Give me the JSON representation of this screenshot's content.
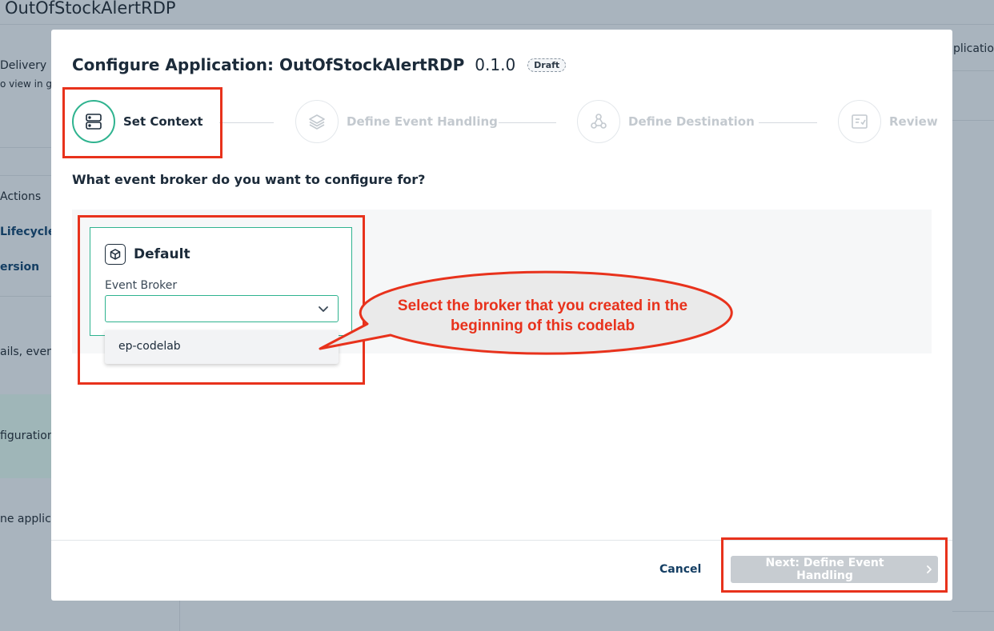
{
  "background": {
    "app_title": "OutOfStockAlertRDP",
    "left_items": [
      {
        "text": "Delivery F",
        "style": "normal"
      },
      {
        "text": "o view in gr",
        "style": "small"
      },
      {
        "text": "Actions",
        "style": "normal"
      },
      {
        "text": "Lifecycle",
        "style": "bold"
      },
      {
        "text": "ersion",
        "style": "bold"
      },
      {
        "text": "ails, even",
        "style": "normal"
      },
      {
        "text": "figuration",
        "style": "normal"
      },
      {
        "text": "ne applic",
        "style": "normal"
      }
    ],
    "right_tab": "plication"
  },
  "modal": {
    "title_prefix": "Configure Application:",
    "app_name": "OutOfStockAlertRDP",
    "version": "0.1.0",
    "status_badge": "Draft",
    "steps": [
      {
        "label": "Set Context",
        "icon": "server-icon",
        "active": true
      },
      {
        "label": "Define Event Handling",
        "icon": "layers-icon",
        "active": false
      },
      {
        "label": "Define Destination",
        "icon": "webhook-icon",
        "active": false
      },
      {
        "label": "Review",
        "icon": "checklist-icon",
        "active": false
      }
    ],
    "question": "What event broker do you want to configure for?",
    "card": {
      "name": "Default",
      "icon": "cube-icon",
      "field_label": "Event Broker",
      "selected_value": ""
    },
    "dropdown_options": [
      "ep-codelab"
    ],
    "footer": {
      "cancel_label": "Cancel",
      "next_label": "Next: Define Event Handling",
      "next_icon": "chevron-right-icon"
    }
  },
  "annotation": {
    "callout_text": "Select the broker that you created in the beginning of this codelab",
    "color": "#e8321c"
  },
  "colors": {
    "accent": "#2fb38f",
    "primary_text": "#1c2b3a",
    "link": "#143e63",
    "disabled_button": "#c7ccd1"
  }
}
